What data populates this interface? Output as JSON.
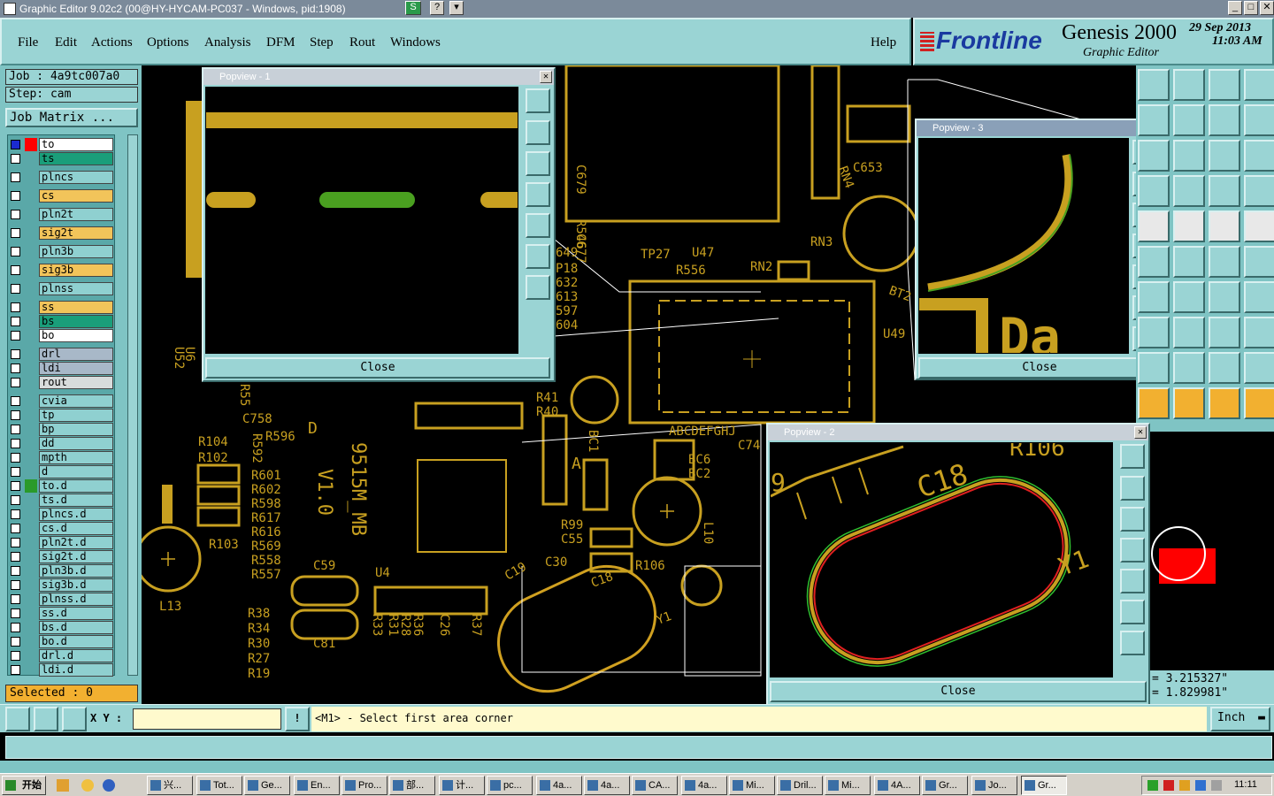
{
  "window": {
    "title": "Graphic Editor 9.02c2 (00@HY-HYCAM-PC037 - Windows, pid:1908)"
  },
  "menu": [
    "File",
    "Edit",
    "Actions",
    "Options",
    "Analysis",
    "DFM",
    "Step",
    "Rout",
    "Windows"
  ],
  "help": "Help",
  "brand": {
    "logo": "Frontline",
    "product": "Genesis 2000",
    "subtitle": "Graphic Editor",
    "date": "29 Sep 2013",
    "time": "11:03 AM"
  },
  "job": {
    "label": "Job : 4a9tc007a0",
    "step": "Step: cam",
    "matrix_button": "Job Matrix ..."
  },
  "layers": [
    {
      "name": "to",
      "color": "#ffffff"
    },
    {
      "name": "ts",
      "color": "#1a9e7a"
    },
    {
      "name": "plncs",
      "color": "#8fd0d0"
    },
    {
      "name": "cs",
      "color": "#f2c45a"
    },
    {
      "name": "pln2t",
      "color": "#8fd0d0"
    },
    {
      "name": "sig2t",
      "color": "#f2c45a"
    },
    {
      "name": "pln3b",
      "color": "#8fd0d0"
    },
    {
      "name": "sig3b",
      "color": "#f2c45a"
    },
    {
      "name": "plnss",
      "color": "#8fd0d0"
    },
    {
      "name": "ss",
      "color": "#f2c45a"
    },
    {
      "name": "bs",
      "color": "#1a9e7a"
    },
    {
      "name": "bo",
      "color": "#ffffff"
    },
    {
      "name": "drl",
      "color": "#a8b8c8"
    },
    {
      "name": "ldi",
      "color": "#a8b8c8"
    },
    {
      "name": "rout",
      "color": "#d8dcdc"
    },
    {
      "name": "cvia",
      "color": "#8fd0d0"
    },
    {
      "name": "tp",
      "color": "#8fd0d0"
    },
    {
      "name": "bp",
      "color": "#8fd0d0"
    },
    {
      "name": "dd",
      "color": "#8fd0d0"
    },
    {
      "name": "mpth",
      "color": "#8fd0d0"
    },
    {
      "name": "d",
      "color": "#8fd0d0"
    },
    {
      "name": "to.d",
      "color": "#8fd0d0"
    },
    {
      "name": "ts.d",
      "color": "#8fd0d0"
    },
    {
      "name": "plncs.d",
      "color": "#8fd0d0"
    },
    {
      "name": "cs.d",
      "color": "#8fd0d0"
    },
    {
      "name": "pln2t.d",
      "color": "#8fd0d0"
    },
    {
      "name": "sig2t.d",
      "color": "#8fd0d0"
    },
    {
      "name": "pln3b.d",
      "color": "#8fd0d0"
    },
    {
      "name": "sig3b.d",
      "color": "#8fd0d0"
    },
    {
      "name": "plnss.d",
      "color": "#8fd0d0"
    },
    {
      "name": "ss.d",
      "color": "#8fd0d0"
    },
    {
      "name": "bs.d",
      "color": "#8fd0d0"
    },
    {
      "name": "bo.d",
      "color": "#8fd0d0"
    },
    {
      "name": "drl.d",
      "color": "#8fd0d0"
    },
    {
      "name": "ldi.d",
      "color": "#8fd0d0"
    }
  ],
  "selected": "Selected : 0",
  "popviews": [
    {
      "title": "Popview - 1",
      "close": "Close"
    },
    {
      "title": "Popview - 2",
      "close": "Close"
    },
    {
      "title": "Popview - 3",
      "close": "Close"
    }
  ],
  "coords": {
    "x": "3.215327\"",
    "y": "1.829981\""
  },
  "status": {
    "xy_label": "X Y :",
    "xy_value": "",
    "prompt": "<M1> - Select first area corner",
    "units": "Inch"
  },
  "board_labels": [
    "C679",
    "R546",
    "C677",
    "TP27",
    "U47",
    "R556",
    "RN2",
    "RN3",
    "RN4",
    "C653",
    "U49",
    "BT2",
    "C758",
    "R104",
    "R102",
    "R103",
    "R596",
    "R601",
    "R602",
    "R598",
    "R617",
    "R616",
    "R569",
    "R558",
    "R557",
    "R592",
    "R55",
    "U52",
    "U6",
    "L13",
    "V1.0",
    "9515M_MB",
    "C59",
    "C81",
    "U4",
    "R38",
    "R34",
    "R30",
    "R27",
    "R19",
    "R33",
    "R31",
    "R28",
    "R36",
    "C26",
    "R37",
    "R41",
    "R40",
    "BC1",
    "A",
    "R99",
    "C55",
    "C30",
    "C19",
    "C18",
    "Y1",
    "R106",
    "BC6",
    "BC2",
    "L10",
    "C74",
    "ABCDEFGHJ",
    "649",
    "P18",
    "632",
    "613",
    "597",
    "604",
    "D"
  ],
  "pop2_labels": [
    "C18",
    "Y1",
    "9",
    "R106"
  ],
  "pop3_labels": [
    "Da"
  ],
  "taskbar": {
    "start": "开始",
    "clock": "11:11",
    "tasks": [
      "兴...",
      "Tot...",
      "Ge...",
      "En...",
      "Pro...",
      "部...",
      "计...",
      "pc...",
      "4a...",
      "4a...",
      "CA...",
      "4a...",
      "Mi...",
      "Dril...",
      "Mi...",
      "4A...",
      "Gr...",
      "Jo...",
      "Gr..."
    ]
  }
}
